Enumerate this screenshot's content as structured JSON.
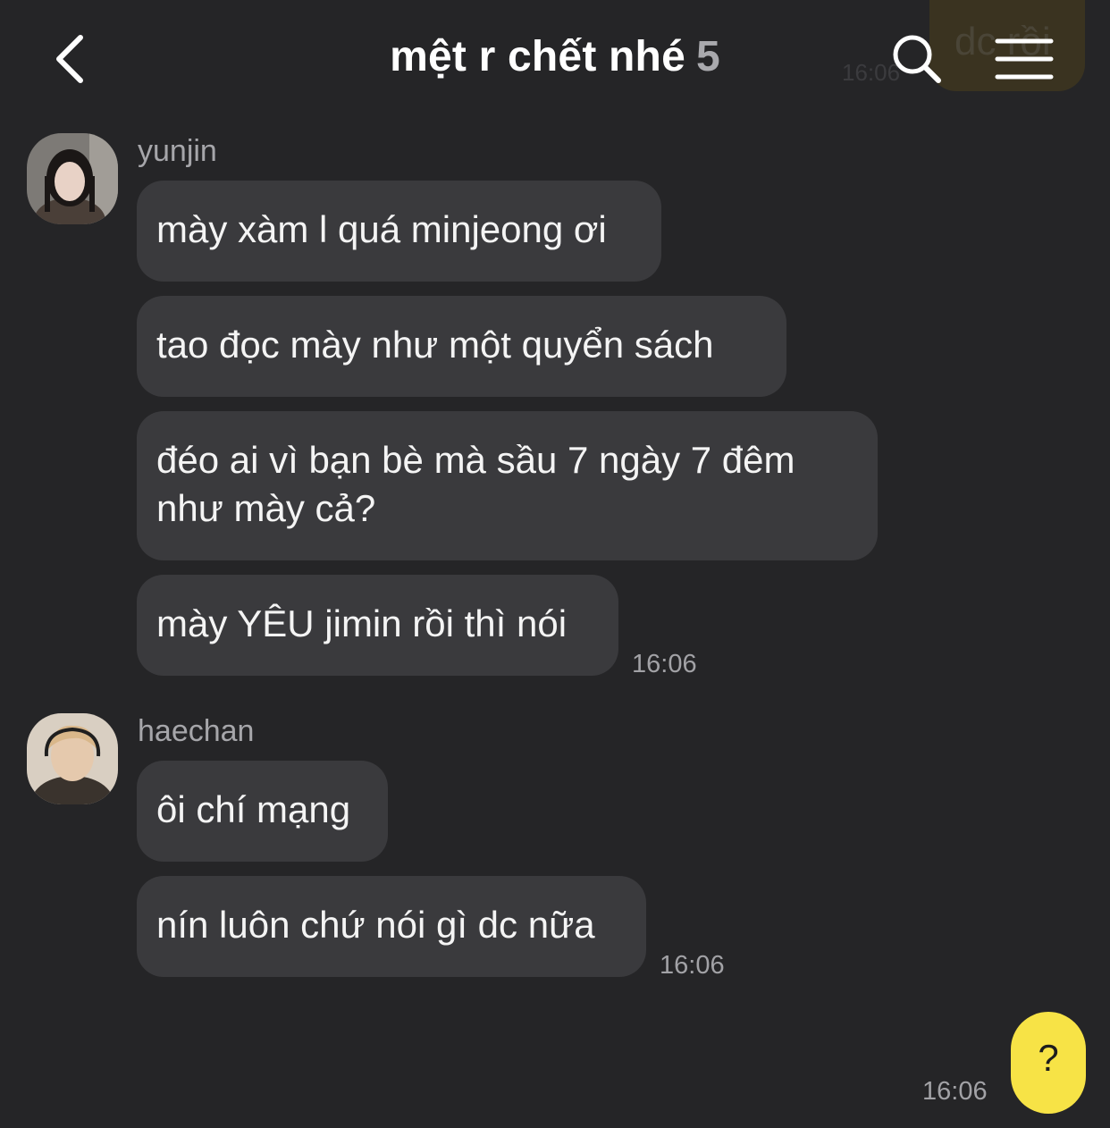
{
  "header": {
    "title": "mệt r chết nhé",
    "member_count": "5"
  },
  "background_message": {
    "text": "dc rồi",
    "time": "16:06"
  },
  "groups": [
    {
      "sender": "yunjin",
      "messages": [
        "mày xàm l quá minjeong ơi",
        "tao đọc mày như một quyển sách",
        "đéo ai vì bạn bè mà sầu 7 ngày 7 đêm như mày cả?",
        "mày YÊU jimin rồi thì nói"
      ],
      "time": "16:06"
    },
    {
      "sender": "haechan",
      "messages": [
        "ôi chí mạng",
        "nín luôn chứ nói gì dc nữa"
      ],
      "time": "16:06"
    }
  ],
  "my_message": {
    "text": "?",
    "time": "16:06"
  },
  "colors": {
    "background": "#252527",
    "bubble_other": "#3a3a3d",
    "bubble_mine": "#f7e346",
    "meta_text": "#a6a6aa"
  }
}
